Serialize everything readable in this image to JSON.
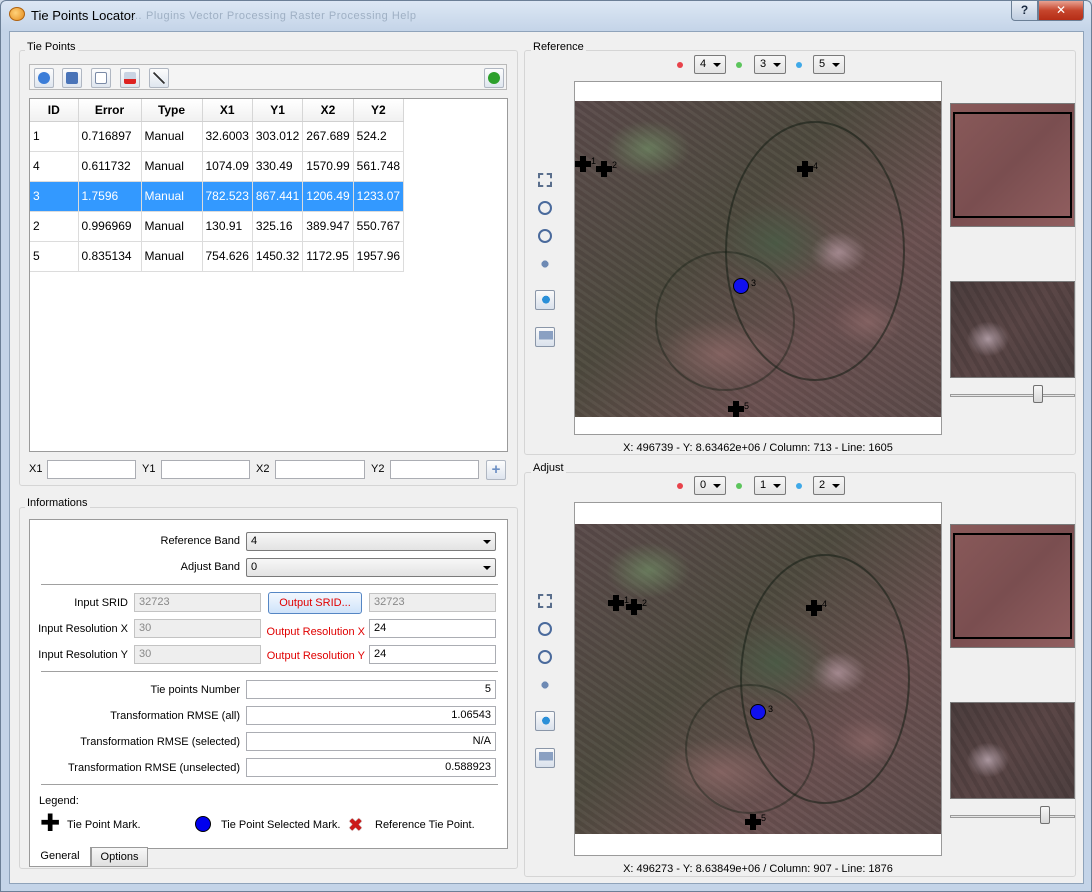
{
  "window": {
    "title": "Tie Points Locator",
    "ghost_menu": "…  Plugins    Vector Processing    Raster Processing    Help",
    "help_label": "?",
    "close_label": "✕"
  },
  "tie_points": {
    "group_title": "Tie Points",
    "columns": [
      "ID",
      "Error",
      "Type",
      "X1",
      "Y1",
      "X2",
      "Y2"
    ],
    "rows": [
      [
        "1",
        "0.716897",
        "Manual",
        "32.6003",
        "303.012",
        "267.689",
        "524.2"
      ],
      [
        "4",
        "0.611732",
        "Manual",
        "1074.09",
        "330.49",
        "1570.99",
        "561.748"
      ],
      [
        "3",
        "1.7596",
        "Manual",
        "782.523",
        "867.441",
        "1206.49",
        "1233.07"
      ],
      [
        "2",
        "0.996969",
        "Manual",
        "130.91",
        "325.16",
        "389.947",
        "550.767"
      ],
      [
        "5",
        "0.835134",
        "Manual",
        "754.626",
        "1450.32",
        "1172.95",
        "1957.96"
      ]
    ],
    "selected_row": 2,
    "coord_labels": {
      "x1": "X1",
      "y1": "Y1",
      "x2": "X2",
      "y2": "Y2"
    },
    "add_label": "+"
  },
  "informations": {
    "group_title": "Informations",
    "reference_band_label": "Reference Band",
    "reference_band_value": "4",
    "adjust_band_label": "Adjust Band",
    "adjust_band_value": "0",
    "input_srid_label": "Input SRID",
    "input_srid_value": "32723",
    "output_srid_button": "Output SRID...",
    "output_srid_value": "32723",
    "input_res_x_label": "Input Resolution X",
    "input_res_x_value": "30",
    "output_res_x_label": "Output Resolution X",
    "output_res_x_value": "24",
    "input_res_y_label": "Input Resolution Y",
    "input_res_y_value": "30",
    "output_res_y_label": "Output Resolution Y",
    "output_res_y_value": "24",
    "tie_points_number_label": "Tie points Number",
    "tie_points_number_value": "5",
    "rmse_all_label": "Transformation RMSE (all)",
    "rmse_all_value": "1.06543",
    "rmse_selected_label": "Transformation RMSE (selected)",
    "rmse_selected_value": "N/A",
    "rmse_unselected_label": "Transformation RMSE (unselected)",
    "rmse_unselected_value": "0.588923",
    "legend_title": "Legend:",
    "legend_mark": "Tie Point Mark.",
    "legend_selected": "Tie Point Selected Mark.",
    "legend_reference": "Reference Tie Point.",
    "tabs": [
      "General",
      "Options"
    ]
  },
  "reference": {
    "group_title": "Reference",
    "bands": [
      "4",
      "3",
      "5"
    ],
    "status": "X: 496739 - Y: 8.63462e+06 / Column: 713 - Line: 1605",
    "slider_level": 0.72,
    "point_labels": [
      "1",
      "2",
      "3",
      "4",
      "5"
    ]
  },
  "adjust": {
    "group_title": "Adjust",
    "bands": [
      "0",
      "1",
      "2"
    ],
    "status": "X: 496273 - Y: 8.63849e+06 / Column: 907 - Line: 1876",
    "slider_level": 0.78,
    "point_labels": [
      "1",
      "2",
      "3",
      "4",
      "5"
    ]
  },
  "colors": {
    "band_red": "#e8424a",
    "band_green": "#5cc55c",
    "band_blue": "#3fa9e8",
    "selection": "#3399ff",
    "alert_text": "#e00000"
  }
}
